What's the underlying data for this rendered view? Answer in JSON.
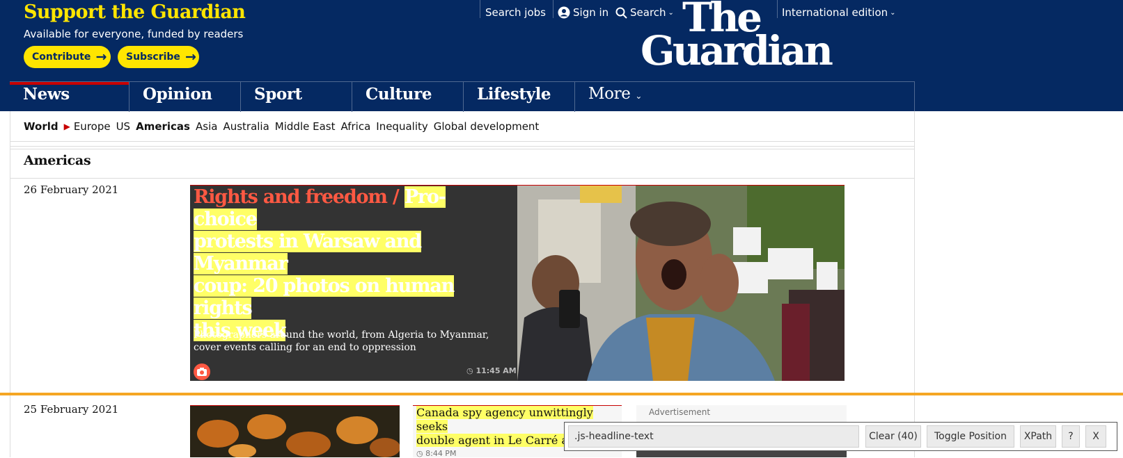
{
  "support": {
    "title": "Support the Guardian",
    "subtitle": "Available for everyone, funded by readers",
    "contribute_label": "Contribute",
    "subscribe_label": "Subscribe"
  },
  "top_nav": {
    "search_jobs": "Search jobs",
    "sign_in": "Sign in",
    "search": "Search",
    "edition": "International edition"
  },
  "logo": {
    "line1": "The",
    "line2": "Guardian"
  },
  "pillars": [
    {
      "label": "News",
      "active": true
    },
    {
      "label": "Opinion"
    },
    {
      "label": "Sport"
    },
    {
      "label": "Culture"
    },
    {
      "label": "Lifestyle"
    },
    {
      "label": "More"
    }
  ],
  "subnav": {
    "items": [
      "World",
      "Europe",
      "US",
      "Americas",
      "Asia",
      "Australia",
      "Middle East",
      "Africa",
      "Inequality",
      "Global development"
    ]
  },
  "section": {
    "title": "Americas"
  },
  "dates": {
    "first": "26 February 2021",
    "second": "25 February 2021"
  },
  "hero": {
    "kicker": "Rights and freedom /",
    "headline_line1": "Pro-choice",
    "headline_line2": "protests in Warsaw and Myanmar",
    "headline_line3": "coup: 20 photos on human rights",
    "headline_line4": "this week",
    "standfirst": "Photographers around the world, from Algeria to Myanmar, cover events calling for an end to oppression",
    "time": "11:45 AM"
  },
  "card": {
    "headline_line1": "Canada spy agency unwittingly seeks",
    "headline_line2": "double agent in Le Carré ad",
    "time": "8:44 PM"
  },
  "advert": {
    "label": "Advertisement"
  },
  "tool": {
    "selector": ".js-headline-text",
    "clear_label": "Clear (40)",
    "toggle_label": "Toggle Position",
    "xpath_label": "XPath",
    "help_label": "?",
    "close_label": "X"
  },
  "colors": {
    "brand_blue": "#052962",
    "brand_yellow": "#ffe500",
    "news_red": "#c70000",
    "kicker_orange": "#ff5943",
    "highlight_yellow": "#ffff66",
    "divider_orange": "#f5a623"
  }
}
